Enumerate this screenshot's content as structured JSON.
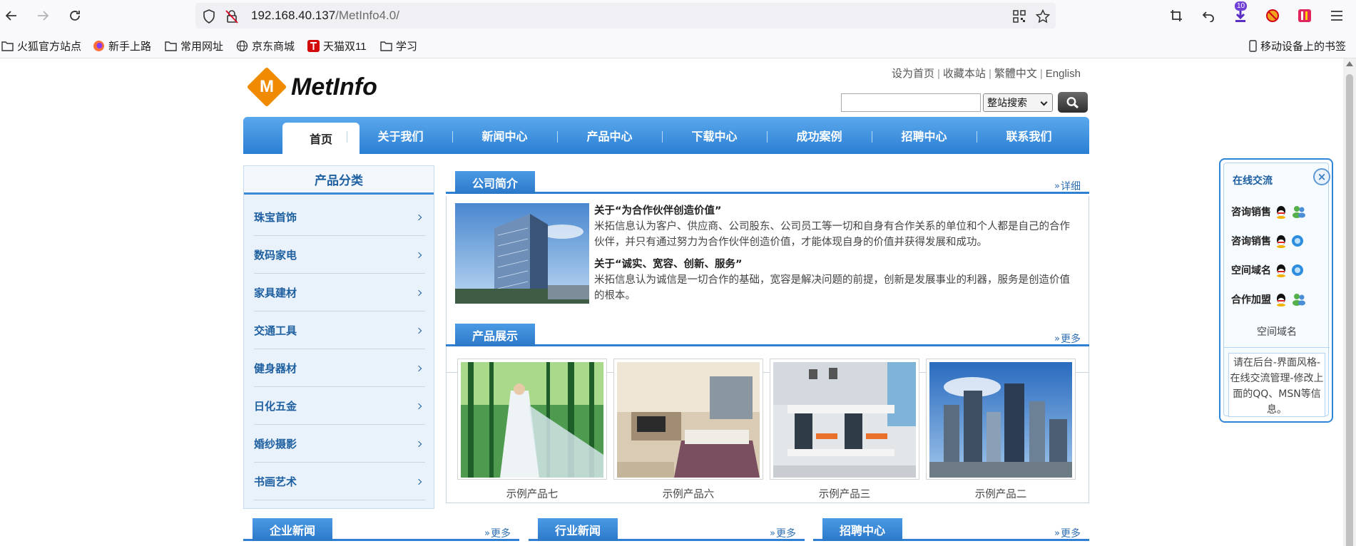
{
  "browser": {
    "url_host": "192.168.40.137",
    "url_path": "/MetInfo4.0/",
    "extension_badge": "10"
  },
  "bookmarks": [
    {
      "label": "火狐官方站点",
      "icon": "folder-icon"
    },
    {
      "label": "新手上路",
      "icon": "firefox-icon"
    },
    {
      "label": "常用网址",
      "icon": "folder-icon"
    },
    {
      "label": "京东商城",
      "icon": "globe-icon"
    },
    {
      "label": "天猫双11",
      "icon": "tmall-icon"
    },
    {
      "label": "学习",
      "icon": "folder-icon"
    }
  ],
  "mobile_bookmarks": "移动设备上的书签",
  "site": {
    "top_links": [
      "设为首页",
      "收藏本站",
      "繁體中文",
      "English"
    ],
    "logo_letter": "M",
    "logo_text": "MetInfo",
    "search_select": "整站搜索",
    "nav": [
      "首页",
      "关于我们",
      "新闻中心",
      "产品中心",
      "下载中心",
      "成功案例",
      "招聘中心",
      "联系我们"
    ],
    "sidebar_title": "产品分类",
    "categories": [
      "珠宝首饰",
      "数码家电",
      "家具建材",
      "交通工具",
      "健身器材",
      "日化五金",
      "婚纱摄影",
      "书画艺术"
    ],
    "about": {
      "tab": "公司简介",
      "more": "详细",
      "h1": "关于“为合作伙伴创造价值”",
      "p1": "米拓信息认为客户、供应商、公司股东、公司员工等一切和自身有合作关系的单位和个人都是自己的合作伙伴，并只有通过努力为合作伙伴创造价值，才能体现自身的价值并获得发展和成功。",
      "h2": "关于“诚实、宽容、创新、服务”",
      "p2": "米拓信息认为诚信是一切合作的基础，宽容是解决问题的前提，创新是发展事业的利器，服务是创造价值的根本。"
    },
    "products": {
      "tab": "产品展示",
      "more": "更多",
      "items": [
        "示例产品七",
        "示例产品六",
        "示例产品三",
        "示例产品二"
      ]
    },
    "bottom_sections": [
      {
        "tab": "企业新闻",
        "more": "更多"
      },
      {
        "tab": "行业新闻",
        "more": "更多"
      },
      {
        "tab": "招聘中心",
        "more": "更多"
      }
    ],
    "chat": {
      "title": "在线交流",
      "close": "×",
      "rows": [
        "咨询销售",
        "咨询销售",
        "空间域名",
        "合作加盟"
      ],
      "footer": "空间域名",
      "note": "请在后台-界面风格-在线交流管理-修改上面的QQ、MSN等信息。"
    }
  },
  "colors": {
    "nav_blue": "#2b7fd4",
    "accent_orange": "#f08a00",
    "link_blue": "#1e5fa0"
  }
}
